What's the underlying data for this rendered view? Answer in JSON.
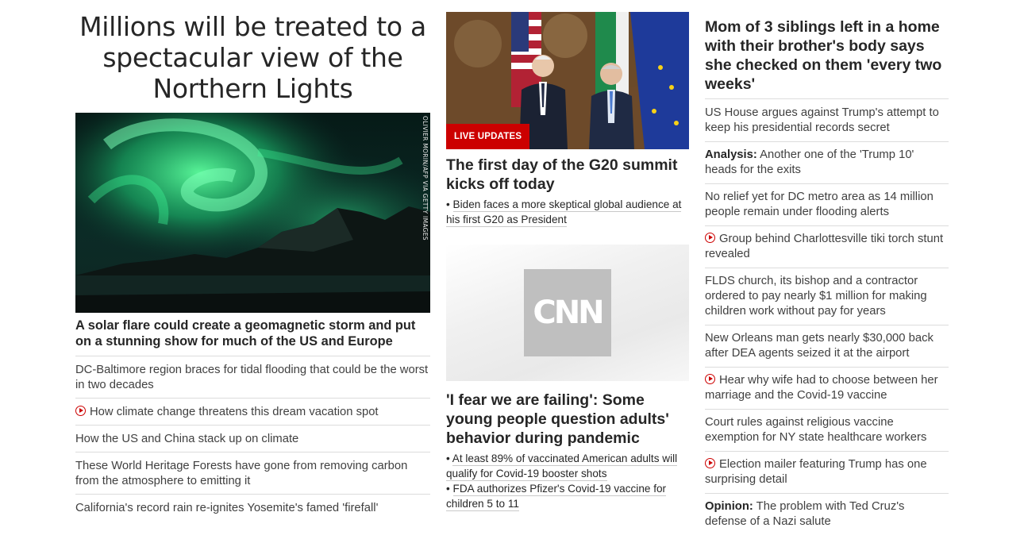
{
  "left": {
    "headline": "Millions will be treated to a spectacular view of the Northern Lights",
    "image_credit": "OLIVIER MORIN/AFP VIA GETTY IMAGES",
    "lead": "A solar flare could create a geomagnetic storm and put on a stunning show for much of the US and Europe",
    "items": [
      {
        "text": "DC-Baltimore region braces for tidal flooding that could be the worst in two decades",
        "video": false
      },
      {
        "text": "How climate change threatens this dream vacation spot",
        "video": true
      },
      {
        "text": "How the US and China stack up on climate",
        "video": false
      },
      {
        "text": "These World Heritage Forests have gone from removing carbon from the atmosphere to emitting it",
        "video": false
      },
      {
        "text": "California's record rain re-ignites Yosemite's famed 'firefall'",
        "video": false
      }
    ]
  },
  "middle": {
    "badge": "LIVE UPDATES",
    "g20_headline": "The first day of the G20 summit kicks off today",
    "g20_bullet": "Biden faces a more skeptical global audience at his first G20 as President",
    "youth_headline": "'I fear we are failing': Some young people question adults' behavior during pandemic",
    "youth_bullets": [
      "At least 89% of vaccinated American adults will qualify for Covid-19 booster shots",
      "FDA authorizes Pfizer's Covid-19 vaccine for children 5 to 11"
    ],
    "logo_text": "CNN"
  },
  "right": {
    "headline": "Mom of 3 siblings left in a home with their brother's body says she checked on them 'every two weeks'",
    "items": [
      {
        "prefix": "",
        "text": "US House argues against Trump's attempt to keep his presidential records secret",
        "video": false
      },
      {
        "prefix": "Analysis:",
        "text": " Another one of the 'Trump 10' heads for the exits",
        "video": false
      },
      {
        "prefix": "",
        "text": "No relief yet for DC metro area as 14 million people remain under flooding alerts",
        "video": false
      },
      {
        "prefix": "",
        "text": "Group behind Charlottesville tiki torch stunt revealed",
        "video": true
      },
      {
        "prefix": "",
        "text": "FLDS church, its bishop and a contractor ordered to pay nearly $1 million for making children work without pay for years",
        "video": false
      },
      {
        "prefix": "",
        "text": "New Orleans man gets nearly $30,000 back after DEA agents seized it at the airport",
        "video": false
      },
      {
        "prefix": "",
        "text": "Hear why wife had to choose between her marriage and the Covid-19 vaccine",
        "video": true
      },
      {
        "prefix": "",
        "text": "Court rules against religious vaccine exemption for NY state healthcare workers",
        "video": false
      },
      {
        "prefix": "",
        "text": "Election mailer featuring Trump has one surprising detail",
        "video": true
      },
      {
        "prefix": "Opinion:",
        "text": " The problem with Ted Cruz's defense of a Nazi salute",
        "video": false
      }
    ]
  }
}
